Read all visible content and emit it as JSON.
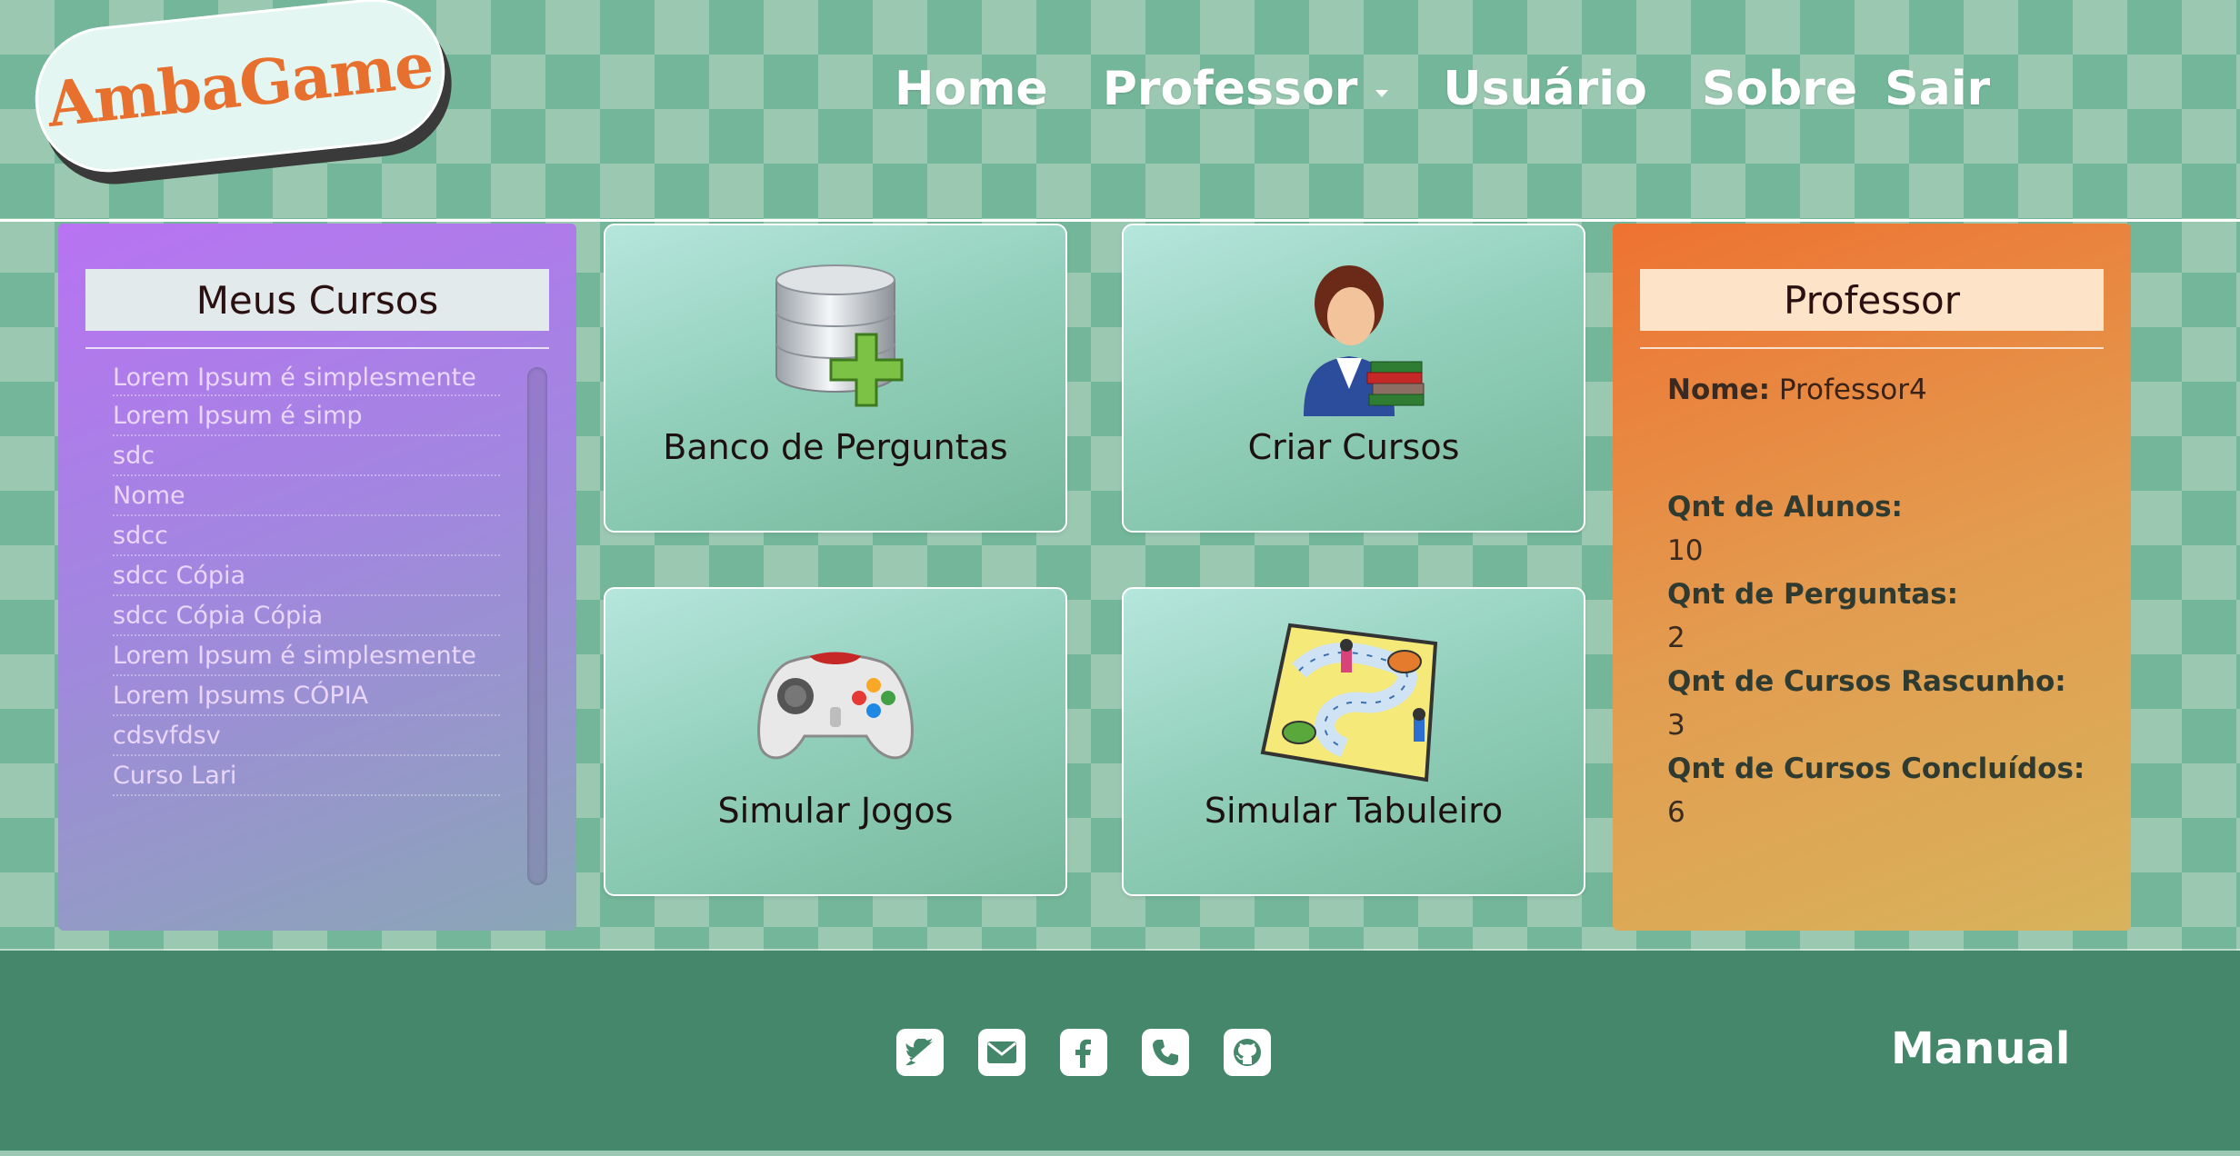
{
  "brand": {
    "logo_text": "AmbaGame",
    "accent": "#e8702e"
  },
  "nav": {
    "home": "Home",
    "professor": "Professor",
    "usuario": "Usuário",
    "sobre": "Sobre",
    "sair": "Sair"
  },
  "courses_panel": {
    "title": "Meus Cursos",
    "items": [
      "Lorem Ipsum é simplesmente",
      "Lorem Ipsum é simp",
      "sdc",
      "Nome",
      "sdcc",
      "sdcc Cópia",
      "sdcc Cópia Cópia",
      "Lorem Ipsum é simplesmente",
      "Lorem Ipsums CÓPIA",
      "cdsvfdsv",
      "Curso Lari"
    ]
  },
  "cards": [
    {
      "label": "Banco de Perguntas",
      "icon": "database-add-icon"
    },
    {
      "label": "Criar Cursos",
      "icon": "teacher-books-icon"
    },
    {
      "label": "Simular Jogos",
      "icon": "gamepad-icon"
    },
    {
      "label": "Simular Tabuleiro",
      "icon": "board-game-icon"
    }
  ],
  "professor_panel": {
    "title": "Professor",
    "name_label": "Nome:",
    "name_value": "Professor4",
    "stats": [
      {
        "label": "Qnt de Alunos:",
        "value": "10"
      },
      {
        "label": "Qnt de Perguntas:",
        "value": "2"
      },
      {
        "label": "Qnt de Cursos Rascunho:",
        "value": "3"
      },
      {
        "label": "Qnt de Cursos Concluídos:",
        "value": "6"
      }
    ]
  },
  "footer": {
    "social_icons": [
      "twitter-icon",
      "mail-icon",
      "facebook-icon",
      "phone-icon",
      "github-icon"
    ],
    "manual": "Manual"
  }
}
